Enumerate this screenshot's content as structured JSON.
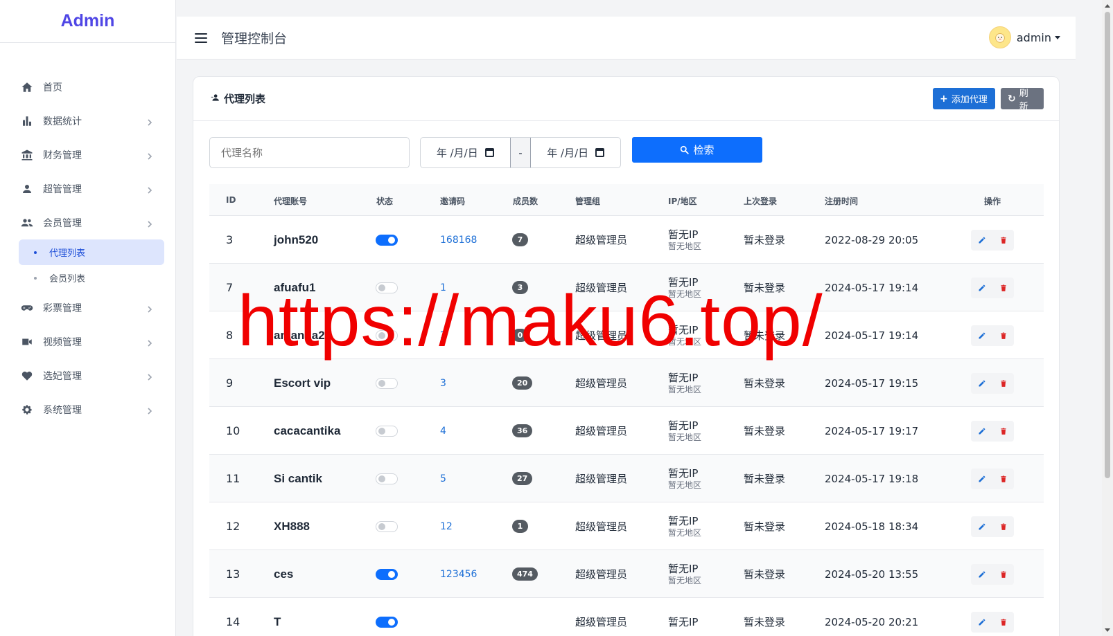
{
  "brand": "Admin",
  "header": {
    "title": "管理控制台",
    "username": "admin"
  },
  "sidebar": {
    "items": [
      {
        "label": "首页",
        "icon": "home-icon",
        "chevron": false
      },
      {
        "label": "数据统计",
        "icon": "bar-chart-icon",
        "chevron": true
      },
      {
        "label": "财务管理",
        "icon": "bank-icon",
        "chevron": true
      },
      {
        "label": "超管管理",
        "icon": "person-icon",
        "chevron": true
      },
      {
        "label": "会员管理",
        "icon": "people-icon",
        "chevron": true
      }
    ],
    "submenu": [
      {
        "label": "代理列表",
        "active": true
      },
      {
        "label": "会员列表",
        "active": false
      }
    ],
    "items_after": [
      {
        "label": "彩票管理",
        "icon": "gamepad-icon",
        "chevron": true
      },
      {
        "label": "视频管理",
        "icon": "video-camera-icon",
        "chevron": true
      },
      {
        "label": "选妃管理",
        "icon": "heart-icon",
        "chevron": true
      },
      {
        "label": "系统管理",
        "icon": "gear-icon",
        "chevron": true
      }
    ]
  },
  "card": {
    "title": "代理列表",
    "add_label": "添加代理",
    "refresh_label": "刷新"
  },
  "filters": {
    "name_placeholder": "代理名称",
    "date_start": "年 /月/日",
    "date_end": "年 /月/日",
    "separator": "-",
    "search_label": "检索"
  },
  "table": {
    "headers": [
      "ID",
      "代理账号",
      "状态",
      "邀请码",
      "成员数",
      "管理组",
      "IP/地区",
      "上次登录",
      "注册时间",
      "操作"
    ],
    "rows": [
      {
        "id": "3",
        "account": "john520",
        "status_on": true,
        "code": "168168",
        "members": "7",
        "group": "超级管理员",
        "ip": "暂无IP",
        "area": "暂无地区",
        "last_login": "暂未登录",
        "registered": "2022-08-29 20:05"
      },
      {
        "id": "7",
        "account": "afuafu1",
        "status_on": false,
        "code": "1",
        "members": "3",
        "group": "超级管理员",
        "ip": "暂无IP",
        "area": "暂无地区",
        "last_login": "暂未登录",
        "registered": "2024-05-17 19:14"
      },
      {
        "id": "8",
        "account": "amanda2",
        "status_on": false,
        "code": "2",
        "members": "0",
        "group": "超级管理员",
        "ip": "暂无IP",
        "area": "暂无地区",
        "last_login": "暂未登录",
        "registered": "2024-05-17 19:14"
      },
      {
        "id": "9",
        "account": "Escort vip",
        "status_on": false,
        "code": "3",
        "members": "20",
        "group": "超级管理员",
        "ip": "暂无IP",
        "area": "暂无地区",
        "last_login": "暂未登录",
        "registered": "2024-05-17 19:15"
      },
      {
        "id": "10",
        "account": "cacacantika",
        "status_on": false,
        "code": "4",
        "members": "36",
        "group": "超级管理员",
        "ip": "暂无IP",
        "area": "暂无地区",
        "last_login": "暂未登录",
        "registered": "2024-05-17 19:17"
      },
      {
        "id": "11",
        "account": "Si cantik",
        "status_on": false,
        "code": "5",
        "members": "27",
        "group": "超级管理员",
        "ip": "暂无IP",
        "area": "暂无地区",
        "last_login": "暂未登录",
        "registered": "2024-05-17 19:18"
      },
      {
        "id": "12",
        "account": "XH888",
        "status_on": false,
        "code": "12",
        "members": "1",
        "group": "超级管理员",
        "ip": "暂无IP",
        "area": "暂无地区",
        "last_login": "暂未登录",
        "registered": "2024-05-18 18:34"
      },
      {
        "id": "13",
        "account": "ces",
        "status_on": true,
        "code": "123456",
        "members": "474",
        "group": "超级管理员",
        "ip": "暂无IP",
        "area": "暂无地区",
        "last_login": "暂未登录",
        "registered": "2024-05-20 13:55"
      },
      {
        "id": "14",
        "account": "T",
        "status_on": true,
        "code": "",
        "members": "",
        "group": "超级管理员",
        "ip": "暂无IP",
        "area": "",
        "last_login": "暂未登录",
        "registered": "2024-05-20 20:21"
      }
    ]
  },
  "watermark": "https://maku6.top/",
  "colors": {
    "brand": "#4f46e5",
    "primary": "#0d6efd",
    "danger": "#dc2626",
    "active_bg": "#dde5fd"
  }
}
